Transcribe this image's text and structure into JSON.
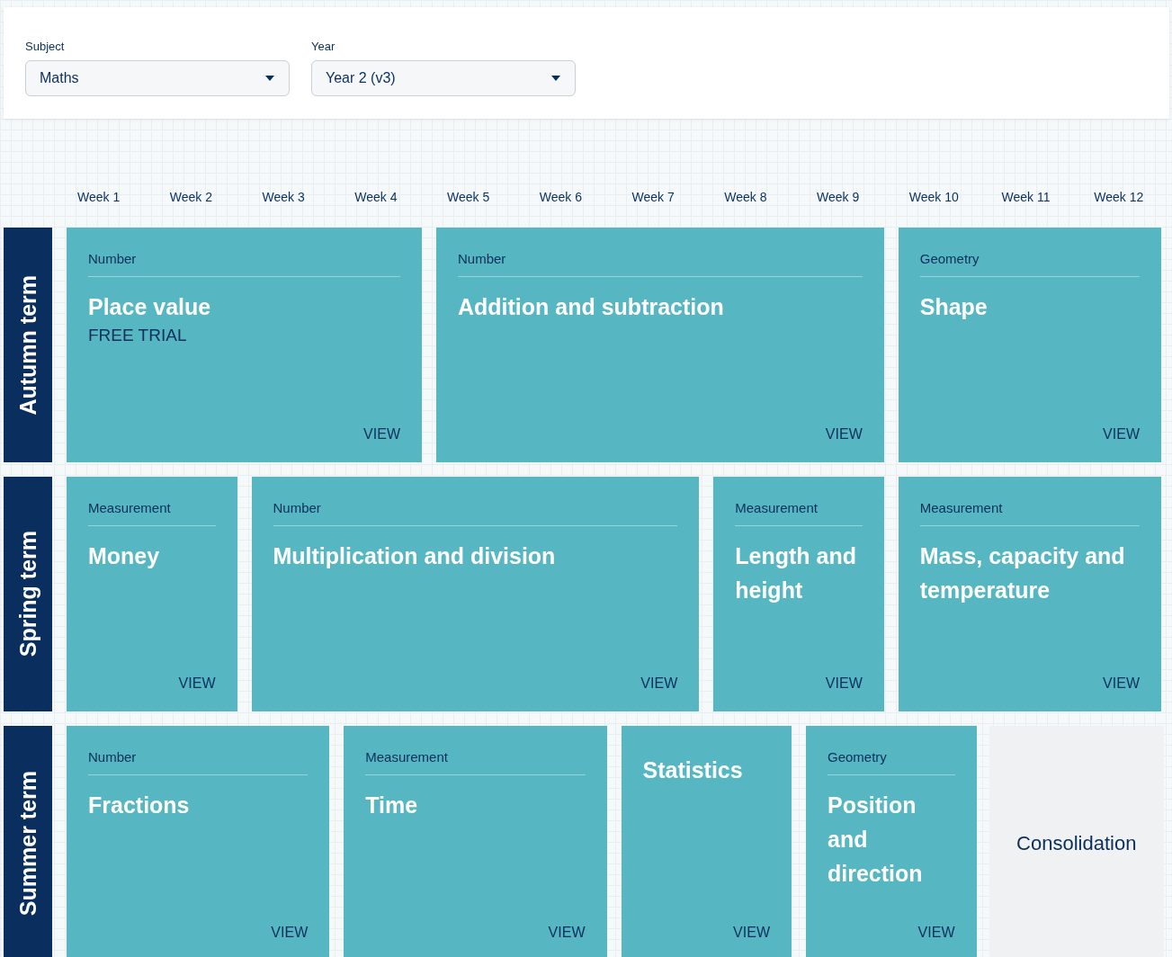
{
  "filters": [
    {
      "label": "Subject",
      "value": "Maths"
    },
    {
      "label": "Year",
      "value": "Year 2 (v3)"
    }
  ],
  "weeks": [
    "Week 1",
    "Week 2",
    "Week 3",
    "Week 4",
    "Week 5",
    "Week 6",
    "Week 7",
    "Week 8",
    "Week 9",
    "Week 10",
    "Week 11",
    "Week 12"
  ],
  "terms": [
    {
      "name": "Autumn term",
      "units": [
        {
          "kind": "unit",
          "category": "Number",
          "title": "Place value",
          "badge": "FREE TRIAL",
          "link": "VIEW"
        },
        {
          "kind": "unit",
          "category": "Number",
          "title": "Addition and subtraction",
          "link": "VIEW"
        },
        {
          "kind": "unit",
          "category": "Geometry",
          "title": "Shape",
          "link": "VIEW"
        }
      ]
    },
    {
      "name": "Spring term",
      "units": [
        {
          "kind": "unit",
          "category": "Measurement",
          "title": "Money",
          "link": "VIEW"
        },
        {
          "kind": "unit",
          "category": "Number",
          "title": "Multiplication and division",
          "link": "VIEW"
        },
        {
          "kind": "unit",
          "category": "Measurement",
          "title": "Length and height",
          "link": "VIEW"
        },
        {
          "kind": "unit",
          "category": "Measurement",
          "title": "Mass, capacity and temperature",
          "link": "VIEW"
        }
      ]
    },
    {
      "name": "Summer term",
      "units": [
        {
          "kind": "unit",
          "category": "Number",
          "title": "Fractions",
          "link": "VIEW"
        },
        {
          "kind": "unit",
          "category": "Measurement",
          "title": "Time",
          "link": "VIEW"
        },
        {
          "kind": "unit",
          "title": "Statistics",
          "link": "VIEW"
        },
        {
          "kind": "unit",
          "category": "Geometry",
          "title": "Position and direction",
          "link": "VIEW"
        },
        {
          "kind": "consolidation",
          "title": "Consolidation"
        }
      ]
    }
  ]
}
